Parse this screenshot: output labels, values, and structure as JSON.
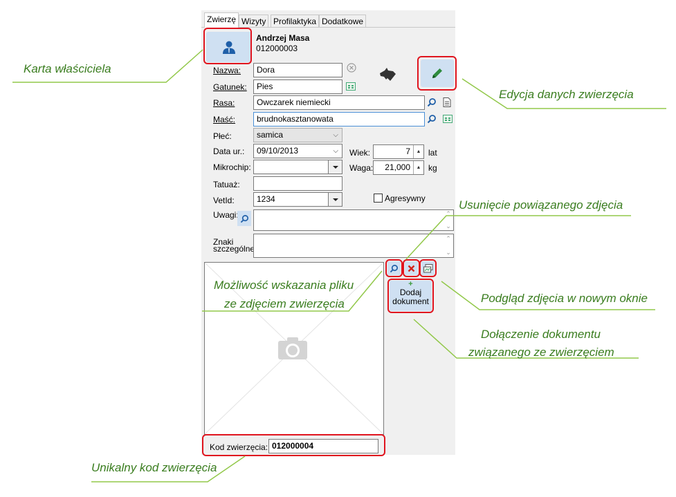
{
  "tabs": [
    {
      "label": "Zwierzę",
      "active": true
    },
    {
      "label": "Wizyty"
    },
    {
      "label": "Profilaktyka"
    },
    {
      "label": "Dodatkowe"
    }
  ],
  "owner": {
    "name": "Andrzej Masa",
    "code": "012000003"
  },
  "form": {
    "nazwa_label": "Nazwa:",
    "nazwa_value": "Dora",
    "gatunek_label": "Gatunek:",
    "gatunek_value": "Pies",
    "rasa_label": "Rasa:",
    "rasa_value": "Owczarek niemiecki",
    "masc_label": "Maść:",
    "masc_value": "brudnokasztanowata",
    "plec_label": "Płeć:",
    "plec_value": "samica",
    "data_label": "Data ur.:",
    "data_value": "09/10/2013",
    "wiek_label": "Wiek:",
    "wiek_value": "7",
    "wiek_unit": "lat",
    "mikrochip_label": "Mikrochip:",
    "mikrochip_value": "",
    "waga_label": "Waga:",
    "waga_value": "21,000",
    "waga_unit": "kg",
    "tatuaz_label": "Tatuaż:",
    "tatuaz_value": "",
    "vetid_label": "VetId:",
    "vetid_value": "1234",
    "agresywny_label": "Agresywny",
    "agresywny_checked": false,
    "uwagi_label": "Uwagi:",
    "uwagi_value": "",
    "znaki_label_1": "Znaki",
    "znaki_label_2": "szczególne:",
    "znaki_value": ""
  },
  "photo": {
    "icon": "camera-icon"
  },
  "add_document": {
    "line1": "Dodaj",
    "line2": "dokument"
  },
  "kod": {
    "label": "Kod zwierzęcia:",
    "value": "012000004"
  },
  "annotations": {
    "karta": "Karta właściciela",
    "edycja": "Edycja danych zwierzęcia",
    "usuniecie": "Usunięcie powiązanego zdjęcia",
    "mozliwosc_1": "Możliwość wskazania pliku",
    "mozliwosc_2": "ze zdjęciem zwierzęcia",
    "podglad": "Podgląd zdjęcia w nowym oknie",
    "dolaczenie_1": "Dołączenie dokumentu",
    "dolaczenie_2": "związanego ze zwierzęciem",
    "unikalny": "Unikalny kod zwierzęcia"
  },
  "colors": {
    "annotation": "#3a7d1f",
    "highlight": "#e0141e",
    "button_bg": "#cfe0f2",
    "accent": "#1f5fa8"
  }
}
